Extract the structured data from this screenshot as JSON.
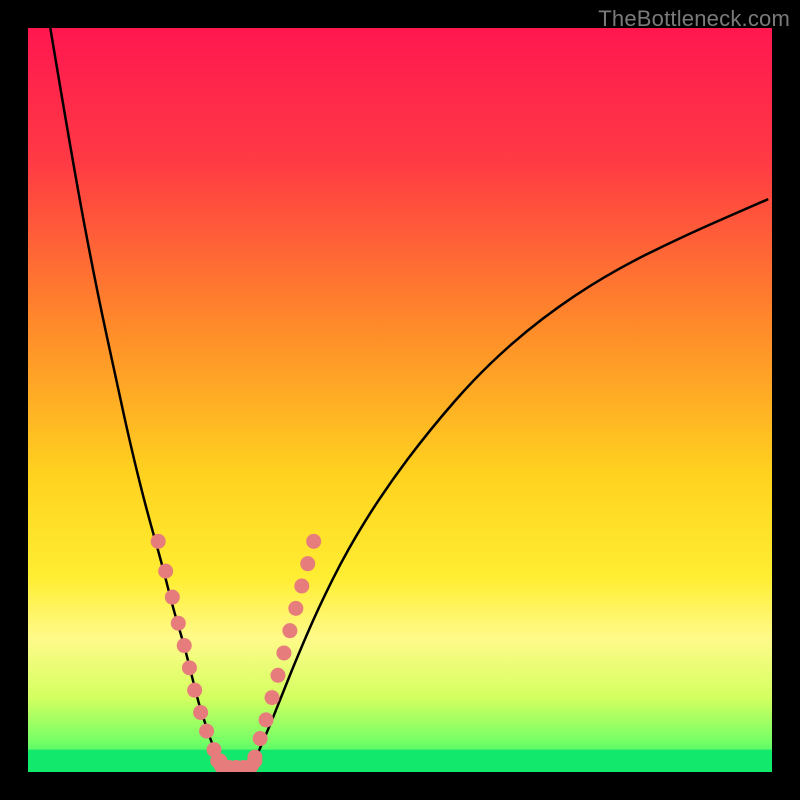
{
  "watermark": "TheBottleneck.com",
  "chart_data": {
    "type": "line",
    "title": "",
    "xlabel": "",
    "ylabel": "",
    "xlim": [
      0,
      100
    ],
    "ylim": [
      0,
      100
    ],
    "grid": false,
    "legend": false,
    "background_gradient": {
      "stops": [
        {
          "offset": 0.0,
          "color": "#ff1750"
        },
        {
          "offset": 0.18,
          "color": "#ff3a44"
        },
        {
          "offset": 0.4,
          "color": "#ff8a2a"
        },
        {
          "offset": 0.6,
          "color": "#ffd21f"
        },
        {
          "offset": 0.74,
          "color": "#ffee33"
        },
        {
          "offset": 0.82,
          "color": "#fffa8a"
        },
        {
          "offset": 0.9,
          "color": "#d4ff60"
        },
        {
          "offset": 0.96,
          "color": "#74ff66"
        },
        {
          "offset": 1.0,
          "color": "#12e86b"
        }
      ]
    },
    "series": [
      {
        "name": "left-curve",
        "type": "line",
        "x": [
          3,
          6,
          9,
          12,
          14,
          16,
          18,
          19.5,
          21,
          22,
          23,
          24,
          25,
          27
        ],
        "y": [
          100,
          82,
          66,
          52,
          43,
          35,
          28,
          22,
          17,
          13,
          9,
          6,
          3,
          0.5
        ]
      },
      {
        "name": "right-curve",
        "type": "line",
        "x": [
          30,
          32,
          34,
          36,
          39,
          43,
          48,
          54,
          61,
          69,
          78,
          88,
          99.5
        ],
        "y": [
          0.5,
          5,
          10,
          15,
          22,
          30,
          38,
          46,
          54,
          61,
          67,
          72,
          77
        ]
      },
      {
        "name": "left-dots",
        "type": "scatter",
        "x": [
          17.5,
          18.5,
          19.4,
          20.2,
          21.0,
          21.7,
          22.4,
          23.2,
          24.0,
          25.0,
          25.8
        ],
        "y": [
          31.0,
          27.0,
          23.5,
          20.0,
          17.0,
          14.0,
          11.0,
          8.0,
          5.5,
          3.0,
          1.5
        ]
      },
      {
        "name": "right-dots",
        "type": "scatter",
        "x": [
          30.5,
          31.2,
          32.0,
          32.8,
          33.6,
          34.4,
          35.2,
          36.0,
          36.8,
          37.6,
          38.4
        ],
        "y": [
          2.0,
          4.5,
          7.0,
          10.0,
          13.0,
          16.0,
          19.0,
          22.0,
          25.0,
          28.0,
          31.0
        ]
      },
      {
        "name": "bottom-marker",
        "type": "scatter",
        "x": [
          26.0,
          27.0,
          28.0,
          29.0,
          30.0,
          25.5,
          30.5
        ],
        "y": [
          0.8,
          0.6,
          0.6,
          0.6,
          0.8,
          1.5,
          1.5
        ]
      }
    ],
    "bottom_band": {
      "from_y": 0,
      "to_y": 3,
      "color": "#12e86b"
    },
    "dot_color": "#e77c7c",
    "line_color": "#000000"
  }
}
